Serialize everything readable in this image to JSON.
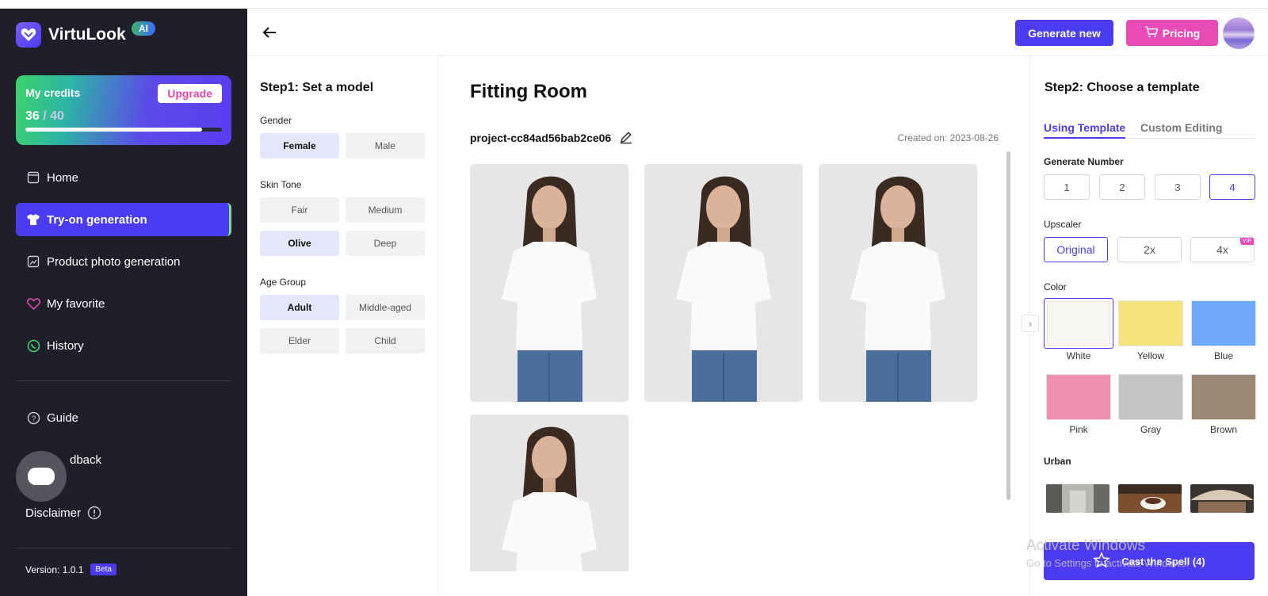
{
  "app": {
    "name": "VirtuLook",
    "ai_badge": "AI"
  },
  "credits": {
    "title": "My credits",
    "used": "36",
    "total": "/ 40",
    "progress": 0.9,
    "upgrade_label": "Upgrade"
  },
  "nav": {
    "home": "Home",
    "tryon": "Try-on generation",
    "product": "Product photo generation",
    "favorite": "My favorite",
    "history": "History",
    "guide": "Guide",
    "feedback": "dback",
    "disclaimer": "Disclaimer"
  },
  "version": {
    "label": "Version: 1.0.1",
    "badge": "Beta"
  },
  "header": {
    "generate_new": "Generate new",
    "pricing": "Pricing"
  },
  "step1": {
    "title": "Step1: Set a model",
    "gender": {
      "label": "Gender",
      "options": [
        "Female",
        "Male"
      ],
      "selected": "Female"
    },
    "skin_tone": {
      "label": "Skin Tone",
      "options": [
        "Fair",
        "Medium",
        "Olive",
        "Deep"
      ],
      "selected": "Olive"
    },
    "age_group": {
      "label": "Age Group",
      "options": [
        "Adult",
        "Middle-aged",
        "Elder",
        "Child"
      ],
      "selected": "Adult"
    }
  },
  "center": {
    "title": "Fitting Room",
    "project_name": "project-cc84ad56bab2ce06",
    "created_label": "Created on:",
    "created_date": "2023-08-26"
  },
  "step2": {
    "title": "Step2: Choose a template",
    "tabs": [
      "Using Template",
      "Custom Editing"
    ],
    "generate_number": {
      "label": "Generate Number",
      "options": [
        "1",
        "2",
        "3",
        "4"
      ],
      "selected": "4"
    },
    "upscaler": {
      "label": "Upscaler",
      "options": [
        "Original",
        "2x",
        "4x"
      ],
      "selected": "Original",
      "vip": "VIP"
    },
    "color": {
      "label": "Color",
      "options": [
        {
          "name": "White",
          "color": "#f8f6f2"
        },
        {
          "name": "Yellow",
          "color": "#f6e27a"
        },
        {
          "name": "Blue",
          "color": "#6fa8f6"
        },
        {
          "name": "Pink",
          "color": "#f090b0"
        },
        {
          "name": "Gray",
          "color": "#c4c4c4"
        },
        {
          "name": "Brown",
          "color": "#9a8775"
        }
      ],
      "selected": "White"
    },
    "urban_label": "Urban",
    "cast_label": "Cast the Spell (4)"
  },
  "watermark": {
    "line1": "Activate Windows",
    "line2": "Go to Settings to activate Windows."
  },
  "colors": {
    "accent": "#4b3cf2",
    "pink": "#e84bb6",
    "sidebar": "#1f1f2b"
  }
}
